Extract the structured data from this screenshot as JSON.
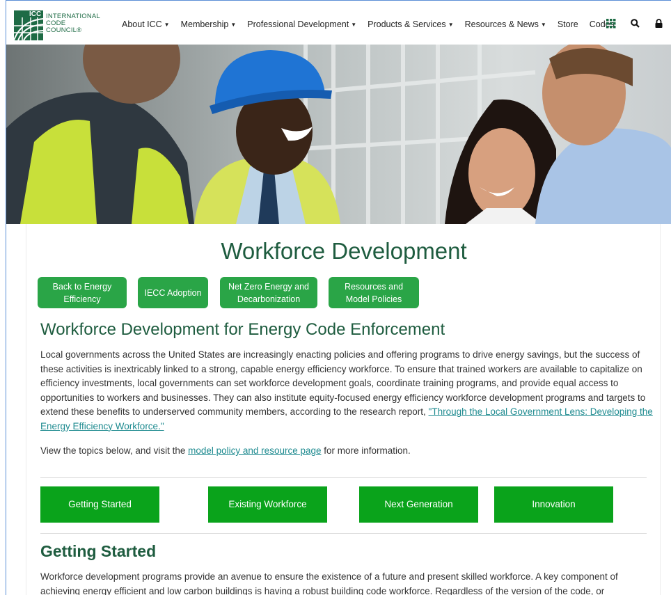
{
  "header": {
    "logo_mark": "ICC",
    "logo_lines": [
      "International",
      "Code",
      "Council®"
    ],
    "nav": [
      {
        "label": "About ICC",
        "dropdown": true
      },
      {
        "label": "Membership",
        "dropdown": true
      },
      {
        "label": "Professional Development",
        "dropdown": true
      },
      {
        "label": "Products & Services",
        "dropdown": true
      },
      {
        "label": "Resources & News",
        "dropdown": true
      },
      {
        "label": "Store",
        "dropdown": false
      },
      {
        "label": "Codes",
        "dropdown": false
      }
    ],
    "icons": [
      "apps-grid-icon",
      "search-icon",
      "lock-icon"
    ]
  },
  "hero": {
    "icon": "photo-construction-workers"
  },
  "main": {
    "title": "Workforce Development",
    "pills": [
      {
        "line1": "Back to Energy",
        "line2": "Efficiency"
      },
      {
        "line1": "IECC Adoption",
        "line2": ""
      },
      {
        "line1": "Net Zero Energy and",
        "line2": "Decarbonization"
      },
      {
        "line1": "Resources and",
        "line2": "Model Policies"
      }
    ],
    "section_heading": "Workforce Development for Energy Code Enforcement",
    "paragraph_text": "Local governments across the United States are increasingly enacting policies and offering programs to drive energy savings, but the success of these activities is inextricably linked to a strong, capable energy efficiency workforce. To ensure that trained workers are available to capitalize on efficiency investments, local governments can set workforce development goals, coordinate training programs, and provide equal access to opportunities to workers and businesses. They can also institute equity-focused energy efficiency workforce development programs and targets to extend these benefits to underserved community members, according to the research report, ",
    "paragraph_link": "\"Through the Local Government Lens: Developing the Energy Efficiency Workforce.\"",
    "topics_prefix": "View the topics below, and visit the ",
    "topics_link": "model policy and resource page",
    "topics_suffix": " for more information.",
    "tabs": [
      "Getting Started",
      "Existing Workforce",
      "Next Generation",
      "Innovation"
    ],
    "getting_started_heading": "Getting Started",
    "getting_started_text": "Workforce development programs provide an avenue to ensure the existence of a future and present skilled workforce.  A key component of achieving energy efficient and low carbon buildings is having a robust building code workforce. Regardless of the version of the code, or"
  },
  "colors": {
    "brand_green": "#1e6b45",
    "button_green": "#2aa547",
    "tab_green": "#0aa31b",
    "heading_green": "#1e5c3f",
    "link_teal": "#1d8a8f"
  }
}
